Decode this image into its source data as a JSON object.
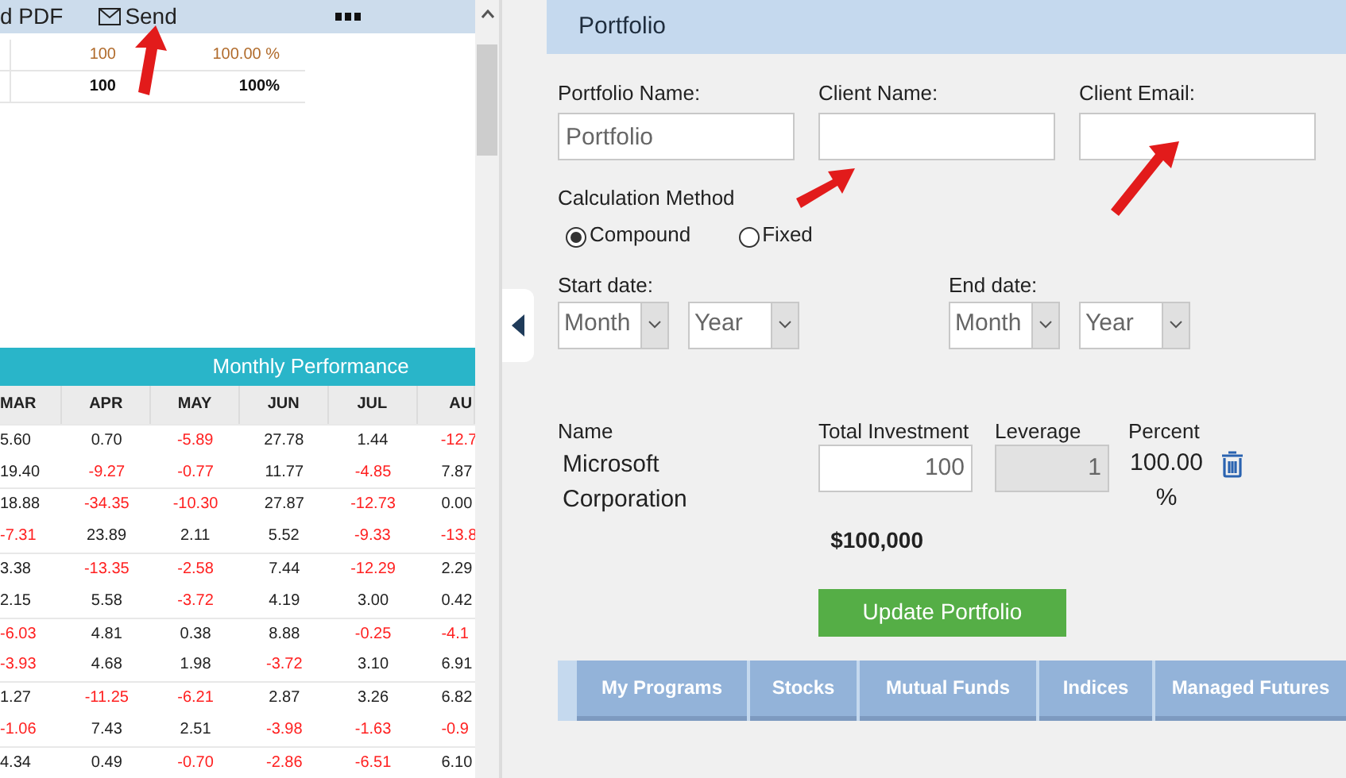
{
  "toolbar": {
    "items": [
      {
        "kind": "text",
        "label": "d PDF"
      },
      {
        "kind": "mail",
        "label": "Send"
      },
      {
        "kind": "more"
      }
    ]
  },
  "summary_table": {
    "rows": [
      {
        "bold": false,
        "investment": "100",
        "weight": "100.00 %"
      },
      {
        "bold": true,
        "investment": "100",
        "weight": "100%"
      }
    ]
  },
  "monthly_performance": {
    "title": "Monthly Performance",
    "columns": [
      "MAR",
      "APR",
      "MAY",
      "JUN",
      "JUL",
      "AU"
    ],
    "rows": [
      {
        "values": [
          "5.60",
          "0.70",
          "-5.89",
          "27.78",
          "1.44",
          "-12.7"
        ],
        "negative": [
          false,
          false,
          true,
          false,
          false,
          true
        ]
      },
      {
        "values": [
          "19.40",
          "-9.27",
          "-0.77",
          "11.77",
          "-4.85",
          "7.87"
        ],
        "negative": [
          false,
          true,
          true,
          false,
          true,
          false
        ]
      },
      {
        "values": [
          "18.88",
          "-34.35",
          "-10.30",
          "27.87",
          "-12.73",
          "0.00"
        ],
        "negative": [
          false,
          true,
          true,
          false,
          true,
          false
        ]
      },
      {
        "values": [
          "-7.31",
          "23.89",
          "2.11",
          "5.52",
          "-9.33",
          "-13.8"
        ],
        "negative": [
          true,
          false,
          false,
          false,
          true,
          true
        ]
      },
      {
        "values": [
          "3.38",
          "-13.35",
          "-2.58",
          "7.44",
          "-12.29",
          "2.29"
        ],
        "negative": [
          false,
          true,
          true,
          false,
          true,
          false
        ]
      },
      {
        "values": [
          "2.15",
          "5.58",
          "-3.72",
          "4.19",
          "3.00",
          "0.42"
        ],
        "negative": [
          false,
          false,
          true,
          false,
          false,
          false
        ]
      },
      {
        "values": [
          "-6.03",
          "4.81",
          "0.38",
          "8.88",
          "-0.25",
          "-4.1"
        ],
        "negative": [
          true,
          false,
          false,
          false,
          true,
          true
        ]
      },
      {
        "values": [
          "-3.93",
          "4.68",
          "1.98",
          "-3.72",
          "3.10",
          "6.91"
        ],
        "negative": [
          true,
          false,
          false,
          true,
          false,
          false
        ]
      },
      {
        "values": [
          "1.27",
          "-11.25",
          "-6.21",
          "2.87",
          "3.26",
          "6.82"
        ],
        "negative": [
          false,
          true,
          true,
          false,
          false,
          false
        ]
      },
      {
        "values": [
          "-1.06",
          "7.43",
          "2.51",
          "-3.98",
          "-1.63",
          "-0.9"
        ],
        "negative": [
          true,
          false,
          false,
          true,
          true,
          true
        ]
      },
      {
        "values": [
          "4.34",
          "0.49",
          "-0.70",
          "-2.86",
          "-6.51",
          "6.10"
        ],
        "negative": [
          false,
          false,
          true,
          true,
          true,
          false
        ]
      }
    ]
  },
  "portfolio": {
    "title": "Portfolio",
    "fields": [
      {
        "label": "Portfolio Name:",
        "value": "Portfolio"
      },
      {
        "label": "Client Name:"
      },
      {
        "label": "Client Email:"
      }
    ],
    "calculation_method": {
      "label": "Calculation Method",
      "options": [
        {
          "label": "Compound",
          "selected": true
        },
        {
          "label": "Fixed",
          "selected": false
        }
      ]
    },
    "dates": [
      {
        "label": "Start date:",
        "month": "Month",
        "year": "Year"
      },
      {
        "label": "End date:",
        "month": "Month",
        "year": "Year"
      }
    ],
    "holdings": {
      "columns": [
        "Name",
        "Total Investment",
        "Leverage",
        "Percent"
      ],
      "rows": [
        {
          "name": "Microsoft Corporation",
          "investment": "100",
          "leverage": "1",
          "percent": "100.00 %"
        }
      ],
      "total": "$100,000"
    },
    "update_button": "Update Portfolio",
    "tabs": [
      "My Programs",
      "Stocks",
      "Mutual Funds",
      "Indices",
      "Managed Futures"
    ]
  }
}
